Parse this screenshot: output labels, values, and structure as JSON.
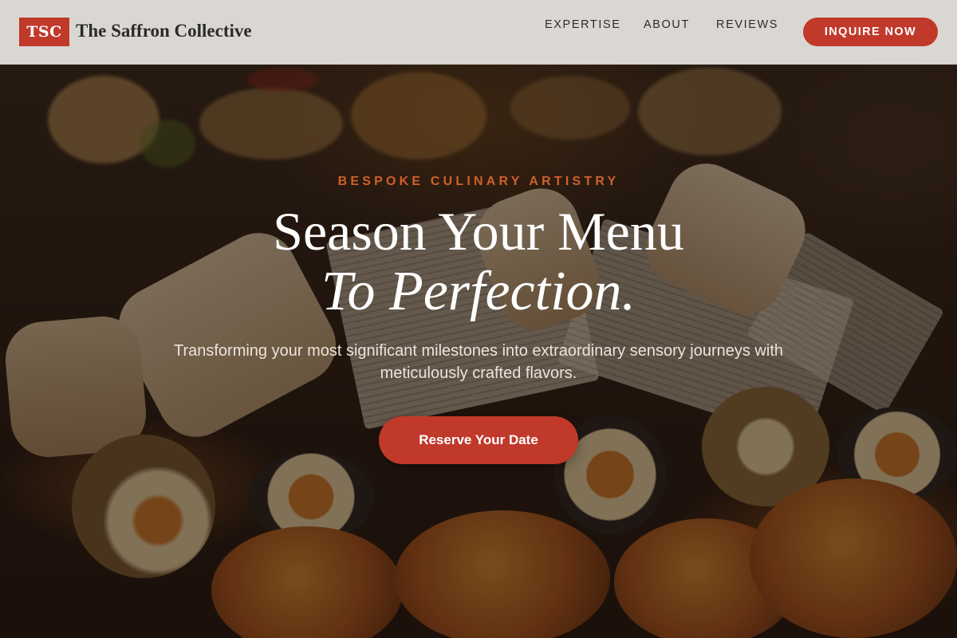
{
  "brand": {
    "badge": "TSC",
    "name": "The Saffron Collective"
  },
  "nav": {
    "items": [
      {
        "label": "EXPERTISE"
      },
      {
        "label": "ABOUT"
      },
      {
        "label": "REVIEWS"
      }
    ],
    "cta_label": "INQUIRE NOW"
  },
  "hero": {
    "eyebrow": "BESPOKE CULINARY ARTISTRY",
    "headline_line1": "Season Your Menu",
    "headline_line2": "To Perfection.",
    "subtitle": "Transforming your most significant milestones into extraordinary sensory journeys with meticulously crafted flavors.",
    "cta_label": "Reserve Your Date",
    "background_image": "food-platter-photo"
  },
  "colors": {
    "accent": "#c0392b",
    "eyebrow": "#d0602a",
    "header_bg": "#e8e6e2"
  }
}
